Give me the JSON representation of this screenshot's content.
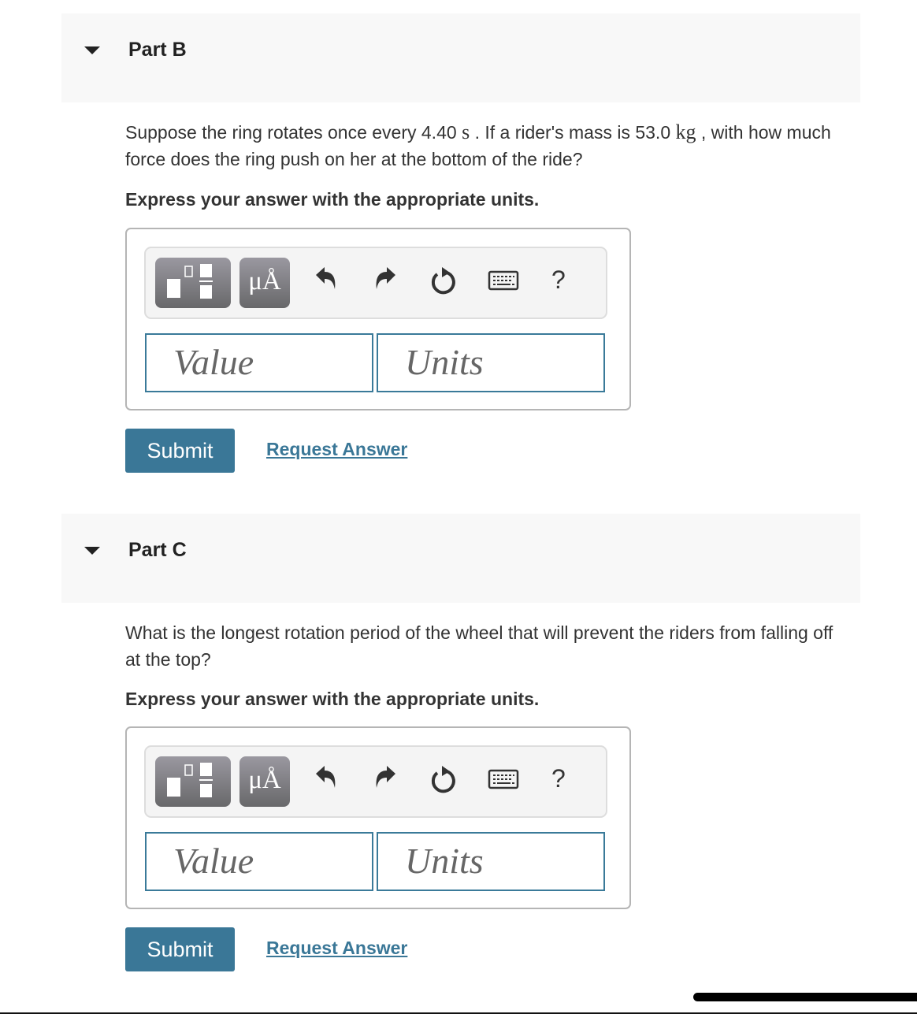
{
  "parts": [
    {
      "title": "Part B",
      "question_pre": "Suppose the ring rotates once every 4.40 ",
      "period_unit": "s",
      "question_mid": " . If a rider's mass is 53.0 ",
      "mass_unit": "kg",
      "question_post": " , with how much force does the ring push on her at the bottom of the ride?",
      "instruction": "Express your answer with the appropriate units.",
      "value_placeholder": "Value",
      "units_placeholder": "Units",
      "submit_label": "Submit",
      "request_answer_label": "Request Answer"
    },
    {
      "title": "Part C",
      "question": "What is the longest rotation period of the wheel that will prevent the riders from falling off at the top?",
      "instruction": "Express your answer with the appropriate units.",
      "value_placeholder": "Value",
      "units_placeholder": "Units",
      "submit_label": "Submit",
      "request_answer_label": "Request Answer"
    }
  ],
  "toolbar": {
    "templates_icon": "fraction-template-icon",
    "symbols_label": "μÅ",
    "undo_icon": "undo-icon",
    "redo_icon": "redo-icon",
    "reset_icon": "reset-icon",
    "keyboard_icon": "keyboard-icon",
    "help_label": "?"
  },
  "colors": {
    "accent": "#3a7797",
    "header_bg": "#f8f8f8",
    "toolbar_button": "#7a797e"
  }
}
